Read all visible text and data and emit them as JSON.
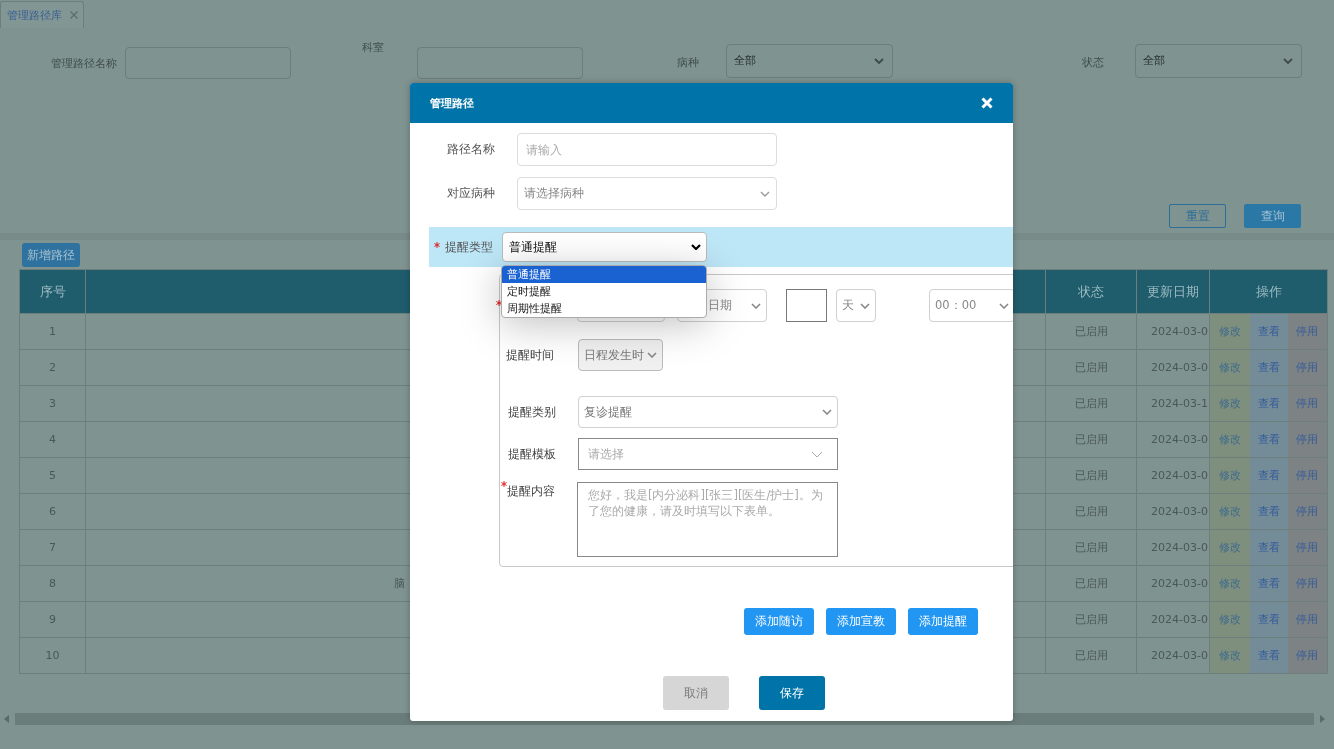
{
  "tabs": [
    {
      "label": "管理路径库",
      "selected": true
    }
  ],
  "filters": [
    {
      "label": "管理路径名称",
      "kind": "input"
    },
    {
      "label": "科室",
      "kind": "input"
    },
    {
      "label": "病种",
      "kind": "select",
      "value": "全部"
    },
    {
      "label": "状态",
      "kind": "select",
      "value": "全部"
    }
  ],
  "filter_buttons": [
    {
      "label": "重置",
      "kind": "outline"
    },
    {
      "label": "查询",
      "kind": "primary"
    }
  ],
  "toolbar_button": "新增路径",
  "table": {
    "columns": [
      "序号",
      "状态",
      "更新日期",
      "操作"
    ],
    "rows": [
      {
        "no": "1",
        "status": "已启用",
        "date": "2024-03-0",
        "actions": [
          "修改",
          "查看",
          "停用"
        ]
      },
      {
        "no": "2",
        "status": "已启用",
        "date": "2024-03-0",
        "actions": [
          "修改",
          "查看",
          "停用"
        ]
      },
      {
        "no": "3",
        "status": "已启用",
        "date": "2024-03-1",
        "actions": [
          "修改",
          "查看",
          "停用"
        ]
      },
      {
        "no": "4",
        "status": "已启用",
        "date": "2024-03-0",
        "actions": [
          "修改",
          "查看",
          "停用"
        ]
      },
      {
        "no": "5",
        "status": "已启用",
        "date": "2024-03-0",
        "actions": [
          "修改",
          "查看",
          "停用"
        ]
      },
      {
        "no": "6",
        "status": "已启用",
        "date": "2024-03-0",
        "actions": [
          "修改",
          "查看",
          "停用"
        ]
      },
      {
        "no": "7",
        "status": "已启用",
        "date": "2024-03-0",
        "actions": [
          "修改",
          "查看",
          "停用"
        ]
      },
      {
        "no": "8",
        "column_2": "脑",
        "status": "已启用",
        "date": "2024-03-0",
        "actions": [
          "修改",
          "查看",
          "停用"
        ]
      },
      {
        "no": "9",
        "status": "已启用",
        "date": "2024-03-0",
        "actions": [
          "修改",
          "查看",
          "停用"
        ]
      },
      {
        "no": "10",
        "status": "已启用",
        "date": "2024-03-0",
        "actions": [
          "修改",
          "查看",
          "停用"
        ]
      }
    ]
  },
  "dialog": {
    "title": "管理路径",
    "fields": [
      {
        "label": "路径名称",
        "kind": "input",
        "placeholder": "请输入"
      },
      {
        "label": "对应病种",
        "kind": "select",
        "placeholder": "请选择病种"
      }
    ],
    "reminder_type": {
      "label": "提醒类型",
      "required": true,
      "value": "普通提醒",
      "expanded": true,
      "options": [
        {
          "label": "普通提醒",
          "selected": true
        },
        {
          "label": "定时提醒",
          "selected": false
        },
        {
          "label": "周期性提醒",
          "selected": false
        }
      ]
    },
    "schedule": {
      "required": true,
      "date_select": "日期",
      "unit_select": "天",
      "time_select": "00：00"
    },
    "reminder_time": {
      "label": "提醒时间",
      "value": "日程发生时",
      "disabled": true
    },
    "category": {
      "label": "提醒类别",
      "value": "复诊提醒"
    },
    "template": {
      "label": "提醒模板",
      "placeholder": "请选择"
    },
    "content": {
      "label": "提醒内容",
      "required": true,
      "placeholder": "您好，我是[内分泌科][张三][医生/护士]。为了您的健康，请及时填写以下表单。"
    },
    "add_buttons": [
      "添加随访",
      "添加宣教",
      "添加提醒"
    ],
    "footer_buttons": [
      {
        "label": "取消",
        "disabled": true
      },
      {
        "label": "保存",
        "disabled": false
      }
    ]
  }
}
